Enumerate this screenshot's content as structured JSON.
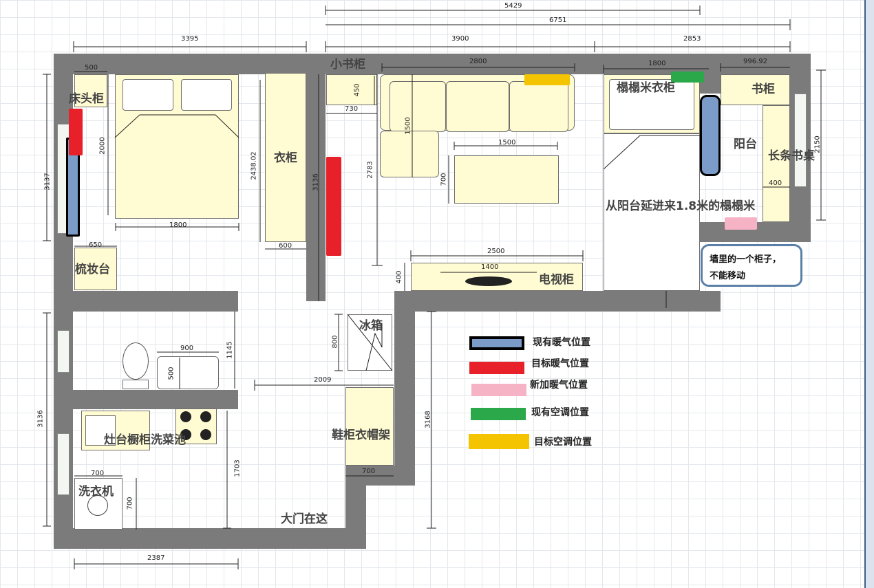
{
  "rooms": {
    "bedside_cabinet": "床头柜",
    "wardrobe": "衣柜",
    "vanity": "梳妆台",
    "small_bookcase": "小书柜",
    "tatami_wardrobe": "榻榻米衣柜",
    "balcony": "阳台",
    "bookcase": "书柜",
    "long_desk": "长条书桌",
    "tatami_extension": "从阳台延进来1.8米的榻榻米",
    "tv_cabinet": "电视柜",
    "fridge": "冰箱",
    "shoe_cabinet": "鞋柜衣帽架",
    "kitchen_counter": "灶台橱柜洗菜池",
    "washer": "洗衣机",
    "main_door": "大门在这"
  },
  "note": {
    "line1": "墙里的一个柜子，",
    "line2": "不能移动"
  },
  "dimensions": {
    "top_5429": "5429",
    "top_6751": "6751",
    "top_3395": "3395",
    "top_3900": "3900",
    "top_2853": "2853",
    "sofa_2800": "2800",
    "tatami_1800": "1800",
    "bookcase_996": "996.92",
    "left_3137": "3137",
    "left_3136": "3136",
    "bedside_500": "500",
    "bed_2000": "2000",
    "bed_1800": "1800",
    "vanity_650": "650",
    "wardrobe_2438": "2438.02",
    "wardrobe_600": "600",
    "wall_3136": "3136",
    "smallbook_450": "450",
    "smallbook_730": "730",
    "room_2783": "2783",
    "sofa_1500v": "1500",
    "table_1500": "1500",
    "table_700": "700",
    "tv_2500": "2500",
    "tv_1400": "1400",
    "tv_400": "400",
    "balcony_2150": "2150",
    "desk_400": "400",
    "bath_900": "900",
    "bath_1145": "1145",
    "sink_500": "500",
    "fridge_800": "800",
    "hall_2009": "2009",
    "hall_3168": "3168",
    "shoe_700": "700",
    "kitchen_1703": "1703",
    "washer_700w": "700",
    "washer_700h": "700",
    "bottom_2387": "2387"
  },
  "legend": [
    {
      "label": "现有暖气位置",
      "color": "#7b9bc8",
      "border": "#000000"
    },
    {
      "label": "目标暖气位置",
      "color": "#e8202a",
      "border": ""
    },
    {
      "label": "新加暖气位置",
      "color": "#f6b3c6",
      "border": ""
    },
    {
      "label": "现有空调位置",
      "color": "#2aa84a",
      "border": ""
    },
    {
      "label": "目标空调位置",
      "color": "#f5c400",
      "border": ""
    }
  ],
  "colors": {
    "wall": "#7b7b7b",
    "furniture": "#fffbd2",
    "existing_heater": "#7b9bc8",
    "target_heater": "#e8202a",
    "new_heater": "#f6b3c6",
    "existing_ac": "#2aa84a",
    "target_ac": "#f5c400"
  }
}
